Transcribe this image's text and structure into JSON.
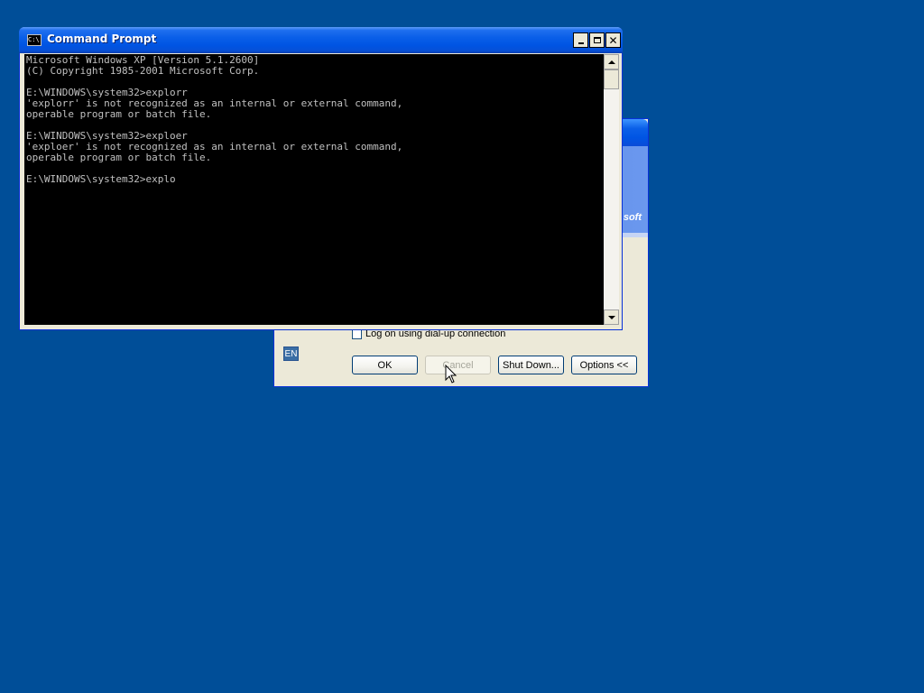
{
  "desktop": {
    "background_color": "#004e98"
  },
  "logon_dialog": {
    "brand_text": "soft",
    "dialup_label": "Log on using dial-up connection",
    "language_indicator": "EN",
    "buttons": {
      "ok": "OK",
      "cancel": "Cancel",
      "shutdown": "Shut Down...",
      "options": "Options <<"
    }
  },
  "command_prompt": {
    "title": "Command Prompt",
    "icon_text": "C:\\",
    "console_lines": [
      "Microsoft Windows XP [Version 5.1.2600]",
      "(C) Copyright 1985-2001 Microsoft Corp.",
      "",
      "E:\\WINDOWS\\system32>explorr",
      "'explorr' is not recognized as an internal or external command,",
      "operable program or batch file.",
      "",
      "E:\\WINDOWS\\system32>exploer",
      "'exploer' is not recognized as an internal or external command,",
      "operable program or batch file.",
      "",
      "E:\\WINDOWS\\system32>explo"
    ],
    "colors": {
      "console_bg": "#000000",
      "console_fg": "#c0c0c0",
      "title_bar": "#0054e3"
    },
    "controls": {
      "minimize": "minimize-icon",
      "maximize": "maximize-icon",
      "close": "close-icon"
    }
  }
}
